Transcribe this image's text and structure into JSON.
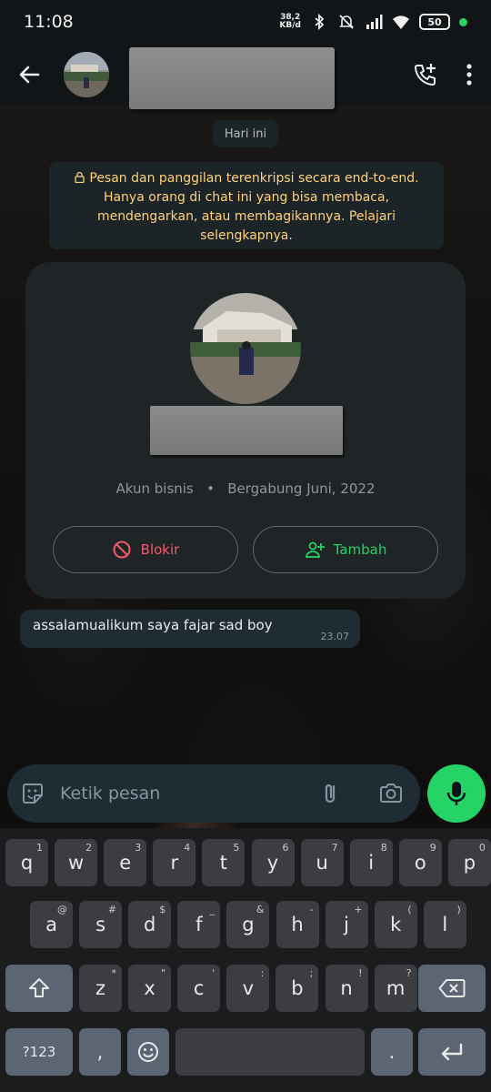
{
  "status_bar": {
    "time": "11:08",
    "net_speed_value": "38,2",
    "net_speed_unit": "KB/d",
    "battery": "50"
  },
  "header": {
    "contact_name": ""
  },
  "chat": {
    "date_chip": "Hari ini",
    "encryption_notice": "Pesan dan panggilan terenkripsi secara end-to-end. Hanya orang di chat ini yang bisa membaca, mendengarkan, atau membagikannya. Pelajari selengkapnya.",
    "profile_card": {
      "account_type": "Akun bisnis",
      "joined": "Bergabung Juni, 2022",
      "block_label": "Blokir",
      "add_label": "Tambah"
    },
    "messages": [
      {
        "text": "assalamualikum saya fajar sad boy",
        "time": "23.07"
      }
    ]
  },
  "composer": {
    "placeholder": "Ketik pesan"
  },
  "keyboard": {
    "row1": [
      {
        "k": "q",
        "s": "1"
      },
      {
        "k": "w",
        "s": "2"
      },
      {
        "k": "e",
        "s": "3"
      },
      {
        "k": "r",
        "s": "4"
      },
      {
        "k": "t",
        "s": "5"
      },
      {
        "k": "y",
        "s": "6"
      },
      {
        "k": "u",
        "s": "7"
      },
      {
        "k": "i",
        "s": "8"
      },
      {
        "k": "o",
        "s": "9"
      },
      {
        "k": "p",
        "s": "0"
      }
    ],
    "row2": [
      {
        "k": "a",
        "s": "@"
      },
      {
        "k": "s",
        "s": "#"
      },
      {
        "k": "d",
        "s": "$"
      },
      {
        "k": "f",
        "s": "_"
      },
      {
        "k": "g",
        "s": "&"
      },
      {
        "k": "h",
        "s": "-"
      },
      {
        "k": "j",
        "s": "+"
      },
      {
        "k": "k",
        "s": "("
      },
      {
        "k": "l",
        "s": ")"
      }
    ],
    "row3": [
      {
        "k": "z",
        "s": "*"
      },
      {
        "k": "x",
        "s": "\""
      },
      {
        "k": "c",
        "s": "'"
      },
      {
        "k": "v",
        "s": ":"
      },
      {
        "k": "b",
        "s": ";"
      },
      {
        "k": "n",
        "s": "!"
      },
      {
        "k": "m",
        "s": "?"
      }
    ],
    "symbols_label": "?123",
    "comma": ",",
    "period": "."
  },
  "colors": {
    "accent": "#25d366",
    "danger": "#f15c6d",
    "notice": "#ffd279"
  }
}
